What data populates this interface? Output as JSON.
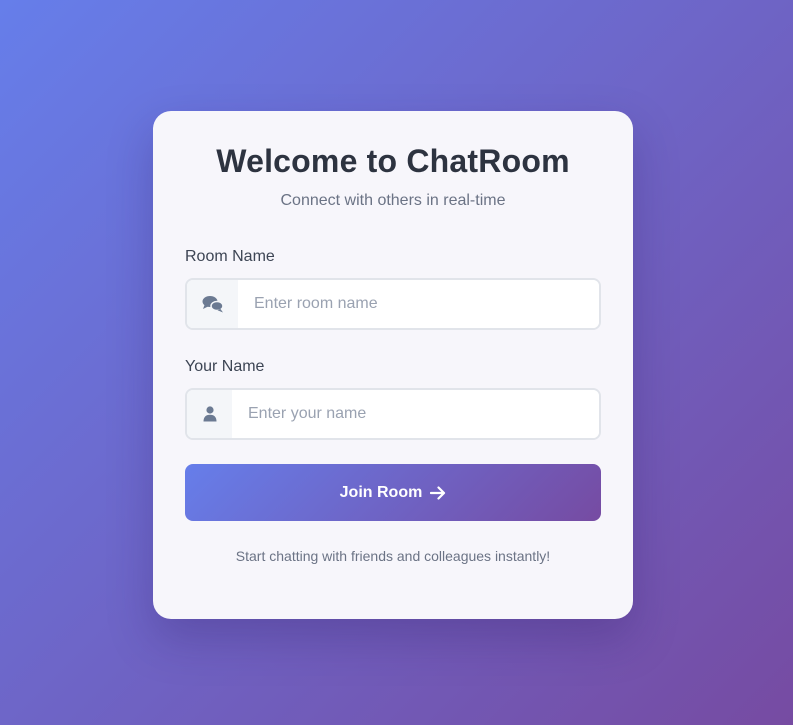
{
  "card": {
    "title": "Welcome to ChatRoom",
    "subtitle": "Connect with others in real-time"
  },
  "room_field": {
    "label": "Room Name",
    "placeholder": "Enter room name",
    "value": "",
    "icon": "comments-icon"
  },
  "name_field": {
    "label": "Your Name",
    "placeholder": "Enter your name",
    "value": "",
    "icon": "user-icon"
  },
  "join_button": {
    "label": "Join Room",
    "icon": "arrow-right-icon"
  },
  "footer": {
    "text": "Start chatting with friends and colleagues instantly!"
  },
  "colors": {
    "gradient_start": "#667eea",
    "gradient_end": "#764ba2",
    "card_background": "#f7f6fb",
    "title_text": "#2d3340",
    "muted_text": "#6b7385",
    "icon_color": "#6b7a92"
  }
}
